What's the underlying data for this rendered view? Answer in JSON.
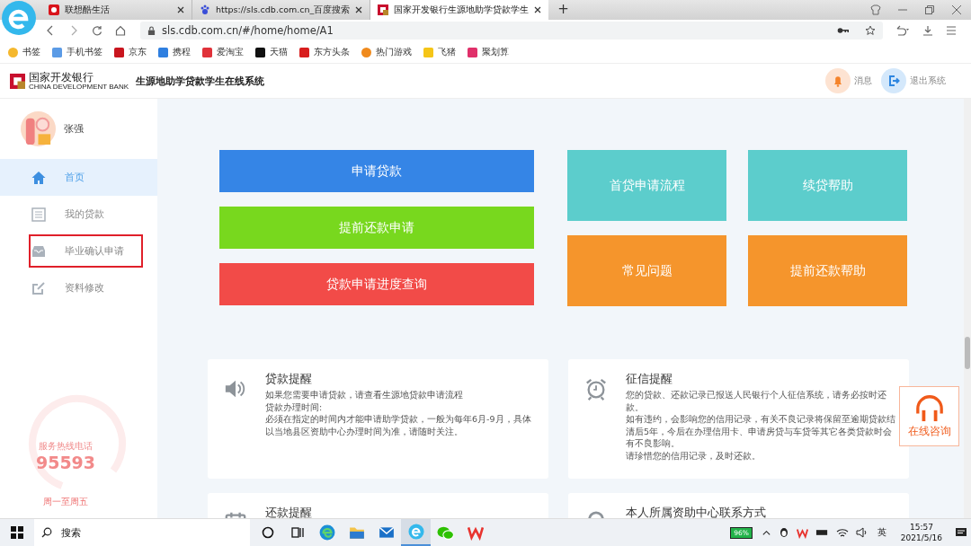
{
  "browser": {
    "tabs": [
      {
        "title": "联想酷生活",
        "selected": false,
        "kind": "red"
      },
      {
        "title": "https://sls.cdb.com.cn_百度搜索",
        "selected": false,
        "kind": "paw"
      },
      {
        "title": "国家开发银行生源地助学贷款学生",
        "selected": true,
        "kind": "bank"
      }
    ],
    "new_tab": "+",
    "url": "sls.cdb.com.cn/#/home/home/A1",
    "bookmarks": [
      {
        "label": "书签",
        "color": "#f5b82e"
      },
      {
        "label": "手机书签",
        "color": "#5b9be6"
      },
      {
        "label": "京东",
        "color": "#c9151e"
      },
      {
        "label": "携程",
        "color": "#2f7fe0"
      },
      {
        "label": "爱淘宝",
        "color": "#e0323a"
      },
      {
        "label": "天猫",
        "color": "#111111"
      },
      {
        "label": "东方头条",
        "color": "#d81e1e"
      },
      {
        "label": "热门游戏",
        "color": "#f08a1c"
      },
      {
        "label": "飞猪",
        "color": "#f5c518"
      },
      {
        "label": "聚划算",
        "color": "#e0306a"
      }
    ]
  },
  "header": {
    "bank_name": "国家开发银行",
    "bank_name_en": "CHINA DEVELOPMENT BANK",
    "system_title": "生源地助学贷款学生在线系统",
    "actions": [
      {
        "kind": "bell",
        "label": "消息"
      },
      {
        "kind": "logout",
        "label": "退出系统"
      }
    ]
  },
  "sidebar": {
    "user": "张强",
    "items": [
      {
        "kind": "home",
        "label": "首页",
        "selected": true,
        "highlighted": false
      },
      {
        "kind": "list",
        "label": "我的贷款",
        "selected": false,
        "highlighted": false
      },
      {
        "kind": "tray",
        "label": "毕业确认申请",
        "selected": false,
        "highlighted": true
      },
      {
        "kind": "edit",
        "label": "资料修改",
        "selected": false,
        "highlighted": false
      }
    ],
    "hotline": {
      "label": "服务热线电话",
      "number": "95593",
      "hours": "周一至周五"
    }
  },
  "actions_left": [
    {
      "label": "申请贷款",
      "color": "#3585e6"
    },
    {
      "label": "提前还款申请",
      "color": "#78d81e"
    },
    {
      "label": "贷款申请进度查询",
      "color": "#f24b48"
    }
  ],
  "actions_right": [
    {
      "label": "首贷申请流程",
      "color": "#5ccdcc"
    },
    {
      "label": "续贷帮助",
      "color": "#5ccdcc"
    },
    {
      "label": "常见问题",
      "color": "#f5952c"
    },
    {
      "label": "提前还款帮助",
      "color": "#f5952c"
    }
  ],
  "cards": [
    {
      "kind": "speaker",
      "title": "贷款提醒",
      "paragraphs": [
        "如果您需要申请贷款，请查看生源地贷款申请流程",
        "贷款办理时间:",
        "必须在指定的时间内才能申请助学贷款，一般为每年6月-9月，具体以当地县区资助中心办理时间为准，请随时关注。"
      ]
    },
    {
      "kind": "clock",
      "title": "征信提醒",
      "paragraphs": [
        "您的贷款、还款记录已报送人民银行个人征信系统，请务必按时还款。",
        "如有违约，会影响您的信用记录，有关不良记录将保留至逾期贷款结清后5年，今后在办理信用卡、申请房贷与车贷等其它各类贷款时会有不良影响。",
        "请珍惜您的信用记录，及时还款。"
      ]
    },
    {
      "kind": "calendar",
      "title": "还款提醒"
    },
    {
      "kind": "person",
      "title": "本人所属资助中心联系方式"
    }
  ],
  "online_help": "在线咨询",
  "taskbar": {
    "search": "搜索",
    "apps": [
      {
        "kind": "cortana",
        "selected": false
      },
      {
        "kind": "taskview",
        "selected": false
      },
      {
        "kind": "edge",
        "selected": false
      },
      {
        "kind": "folder",
        "selected": false
      },
      {
        "kind": "mail",
        "selected": false
      },
      {
        "kind": "browser",
        "selected": true
      },
      {
        "kind": "wechat",
        "selected": false
      },
      {
        "kind": "wps",
        "selected": false
      }
    ],
    "battery": "96%",
    "language": "英",
    "time": "15:57",
    "date": "2021/5/16"
  }
}
